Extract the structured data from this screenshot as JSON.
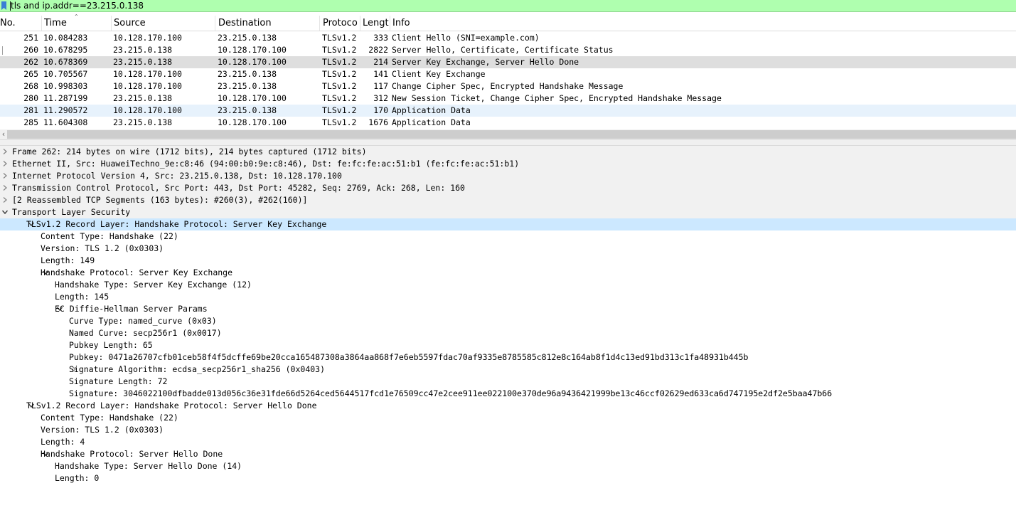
{
  "filter": {
    "text": "tls and ip.addr==23.215.0.138"
  },
  "packet_list": {
    "columns": [
      "No.",
      "Time",
      "Source",
      "Destination",
      "Protoco",
      "Lengt",
      "Info"
    ],
    "rows": [
      {
        "no": "251",
        "time": "10.084283",
        "src": "10.128.170.100",
        "dst": "23.215.0.138",
        "proto": "TLSv1.2",
        "len": "333",
        "info": "Client Hello (SNI=example.com)"
      },
      {
        "no": "260",
        "time": "10.678295",
        "src": "23.215.0.138",
        "dst": "10.128.170.100",
        "proto": "TLSv1.2",
        "len": "2822",
        "info": "Server Hello, Certificate, Certificate Status"
      },
      {
        "no": "262",
        "time": "10.678369",
        "src": "23.215.0.138",
        "dst": "10.128.170.100",
        "proto": "TLSv1.2",
        "len": "214",
        "info": "Server Key Exchange, Server Hello Done"
      },
      {
        "no": "265",
        "time": "10.705567",
        "src": "10.128.170.100",
        "dst": "23.215.0.138",
        "proto": "TLSv1.2",
        "len": "141",
        "info": "Client Key Exchange"
      },
      {
        "no": "268",
        "time": "10.998303",
        "src": "10.128.170.100",
        "dst": "23.215.0.138",
        "proto": "TLSv1.2",
        "len": "117",
        "info": "Change Cipher Spec, Encrypted Handshake Message"
      },
      {
        "no": "280",
        "time": "11.287199",
        "src": "23.215.0.138",
        "dst": "10.128.170.100",
        "proto": "TLSv1.2",
        "len": "312",
        "info": "New Session Ticket, Change Cipher Spec, Encrypted Handshake Message"
      },
      {
        "no": "281",
        "time": "11.290572",
        "src": "10.128.170.100",
        "dst": "23.215.0.138",
        "proto": "TLSv1.2",
        "len": "170",
        "info": "Application Data"
      },
      {
        "no": "285",
        "time": "11.604308",
        "src": "23.215.0.138",
        "dst": "10.128.170.100",
        "proto": "TLSv1.2",
        "len": "1676",
        "info": "Application Data"
      }
    ],
    "selected_no": "262"
  },
  "details": [
    {
      "text": "Frame 262: 214 bytes on wire (1712 bits), 214 bytes captured (1712 bits)",
      "arrow": "right"
    },
    {
      "text": "Ethernet II, Src: HuaweiTechno_9e:c8:46 (94:00:b0:9e:c8:46), Dst: fe:fc:fe:ac:51:b1 (fe:fc:fe:ac:51:b1)",
      "arrow": "right"
    },
    {
      "text": "Internet Protocol Version 4, Src: 23.215.0.138, Dst: 10.128.170.100",
      "arrow": "right"
    },
    {
      "text": "Transmission Control Protocol, Src Port: 443, Dst Port: 45282, Seq: 2769, Ack: 268, Len: 160",
      "arrow": "right"
    },
    {
      "text": "[2 Reassembled TCP Segments (163 bytes): #260(3), #262(160)]",
      "arrow": "right"
    },
    {
      "text": "Transport Layer Security",
      "arrow": "down"
    },
    {
      "text": "TLSv1.2 Record Layer: Handshake Protocol: Server Key Exchange",
      "arrow": "down"
    },
    {
      "text": "Content Type: Handshake (22)",
      "arrow": ""
    },
    {
      "text": "Version: TLS 1.2 (0x0303)",
      "arrow": ""
    },
    {
      "text": "Length: 149",
      "arrow": ""
    },
    {
      "text": "Handshake Protocol: Server Key Exchange",
      "arrow": "down"
    },
    {
      "text": "Handshake Type: Server Key Exchange (12)",
      "arrow": ""
    },
    {
      "text": "Length: 145",
      "arrow": ""
    },
    {
      "text": "EC Diffie-Hellman Server Params",
      "arrow": "down"
    },
    {
      "text": "Curve Type: named_curve (0x03)",
      "arrow": ""
    },
    {
      "text": "Named Curve: secp256r1 (0x0017)",
      "arrow": ""
    },
    {
      "text": "Pubkey Length: 65",
      "arrow": ""
    },
    {
      "text": "Pubkey: 0471a26707cfb01ceb58f4f5dcffe69be20cca165487308a3864aa868f7e6eb5597fdac70af9335e8785585c812e8c164ab8f1d4c13ed91bd313c1fa48931b445b",
      "arrow": ""
    },
    {
      "text": "Signature Algorithm: ecdsa_secp256r1_sha256 (0x0403)",
      "arrow": "right"
    },
    {
      "text": "Signature Length: 72",
      "arrow": ""
    },
    {
      "text": "Signature: 3046022100dfbadde013d056c36e31fde66d5264ced5644517fcd1e76509cc47e2cee911ee022100e370de96a9436421999be13c46ccf02629ed633ca6d747195e2df2e5baa47b66",
      "arrow": ""
    },
    {
      "text": "TLSv1.2 Record Layer: Handshake Protocol: Server Hello Done",
      "arrow": "down"
    },
    {
      "text": "Content Type: Handshake (22)",
      "arrow": ""
    },
    {
      "text": "Version: TLS 1.2 (0x0303)",
      "arrow": ""
    },
    {
      "text": "Length: 4",
      "arrow": ""
    },
    {
      "text": "Handshake Protocol: Server Hello Done",
      "arrow": "down"
    },
    {
      "text": "Handshake Type: Server Hello Done (14)",
      "arrow": ""
    },
    {
      "text": "Length: 0",
      "arrow": ""
    }
  ],
  "colors": {
    "filter_bg": "#afffaf",
    "selected_row": "#dedede",
    "app_data_row": "#e7f2fc",
    "tree_selected": "#cce8ff"
  }
}
